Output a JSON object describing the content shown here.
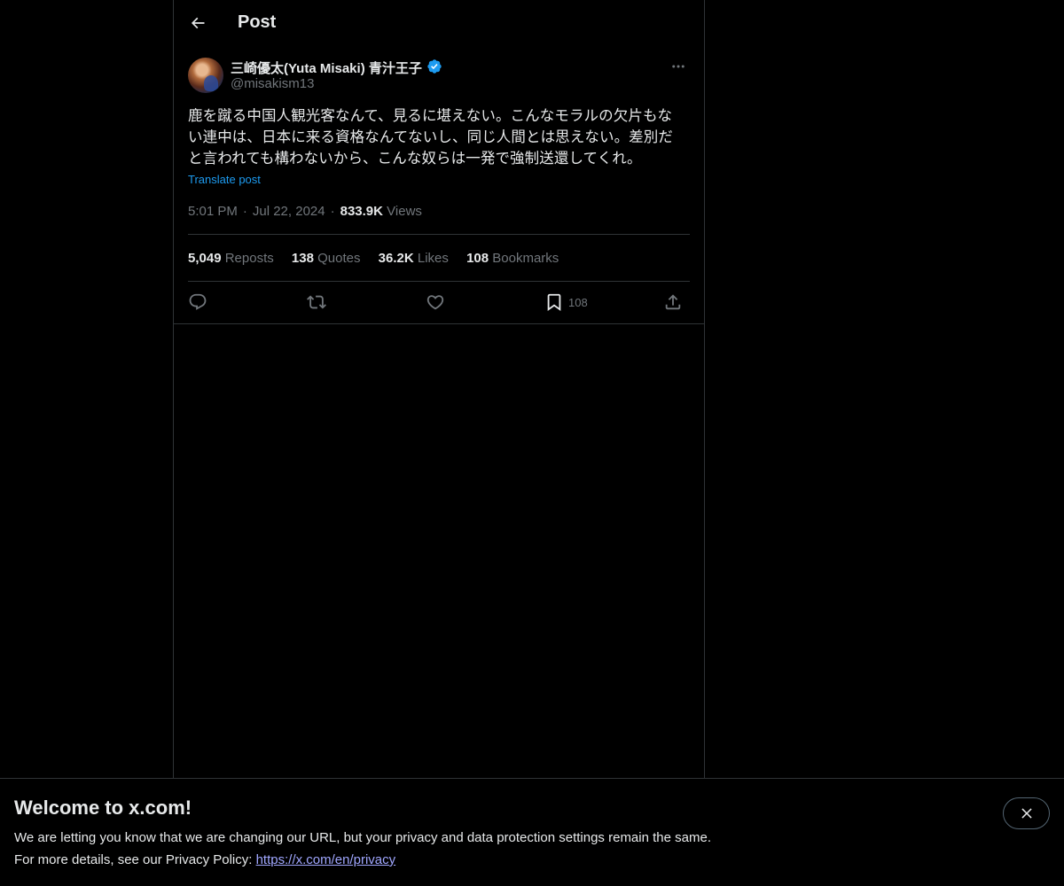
{
  "header": {
    "title": "Post"
  },
  "post": {
    "author": {
      "display_name": "三崎優太(Yuta Misaki) 青汁王子",
      "handle": "@misakism13",
      "verified": true
    },
    "text_lines": [
      "鹿を蹴る中国人観光客なんて、見るに堪えない。こんなモラルの欠片もな",
      "い連中は、日本に来る資格なんてないし、同じ人間とは思えない。差別だ",
      "と言われても構わないから、こんな奴らは一発で強制送還してくれ。"
    ],
    "translate_label": "Translate post",
    "time": "5:01 PM",
    "date": "Jul 22, 2024",
    "views_count": "833.9K",
    "views_label": "Views",
    "stats": {
      "reposts": {
        "count": "5,049",
        "label": "Reposts"
      },
      "quotes": {
        "count": "138",
        "label": "Quotes"
      },
      "likes": {
        "count": "36.2K",
        "label": "Likes"
      },
      "bookmarks": {
        "count": "108",
        "label": "Bookmarks"
      }
    },
    "actions": {
      "bookmark_count": "108"
    }
  },
  "banner": {
    "title": "Welcome to x.com!",
    "line1": "We are letting you know that we are changing our URL, but your privacy and data protection settings remain the same.",
    "line2_prefix": "For more details, see our Privacy Policy: ",
    "link_text": "https://x.com/en/privacy"
  },
  "colors": {
    "background": "#000000",
    "text": "#e7e9ea",
    "secondary": "#71767b",
    "accent": "#1d9bf0",
    "border": "#2f3336",
    "link": "#a0a7ff"
  },
  "icons": {
    "back": "arrow-left-icon",
    "verified": "verified-badge-icon",
    "more": "more-horizontal-icon",
    "reply": "reply-icon",
    "repost": "repost-icon",
    "like": "heart-icon",
    "bookmark": "bookmark-icon",
    "share": "share-icon",
    "close": "close-icon"
  }
}
